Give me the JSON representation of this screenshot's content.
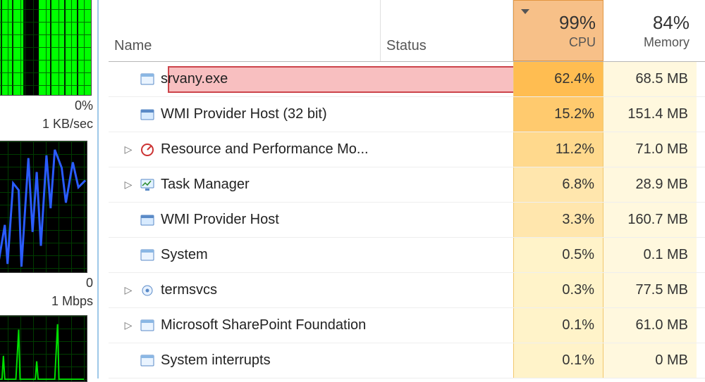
{
  "sidebar": {
    "cpu_label": "0%",
    "kb_label": "1 KB/sec",
    "zero_label": "0",
    "mbps_label": "1 Mbps"
  },
  "header": {
    "name": "Name",
    "status": "Status",
    "cpu_value": "99%",
    "cpu_label": "CPU",
    "mem_value": "84%",
    "mem_label": "Memory"
  },
  "rows": [
    {
      "expandable": false,
      "icon": "window",
      "name": "srvany.exe",
      "cpu": "62.4%",
      "mem": "68.5 MB",
      "heat": "heat-0",
      "highlight": true
    },
    {
      "expandable": false,
      "icon": "gear",
      "name": "WMI Provider Host (32 bit)",
      "cpu": "15.2%",
      "mem": "151.4 MB",
      "heat": "heat-1"
    },
    {
      "expandable": true,
      "icon": "meter",
      "name": "Resource and Performance Mo...",
      "cpu": "11.2%",
      "mem": "71.0 MB",
      "heat": "heat-2"
    },
    {
      "expandable": true,
      "icon": "monitor",
      "name": "Task Manager",
      "cpu": "6.8%",
      "mem": "28.9 MB",
      "heat": "heat-3"
    },
    {
      "expandable": false,
      "icon": "gear",
      "name": "WMI Provider Host",
      "cpu": "3.3%",
      "mem": "160.7 MB",
      "heat": "heat-3"
    },
    {
      "expandable": false,
      "icon": "window",
      "name": "System",
      "cpu": "0.5%",
      "mem": "0.1 MB",
      "heat": "heat-light"
    },
    {
      "expandable": true,
      "icon": "cog",
      "name": "termsvcs",
      "cpu": "0.3%",
      "mem": "77.5 MB",
      "heat": "heat-light"
    },
    {
      "expandable": true,
      "icon": "window",
      "name": "Microsoft SharePoint Foundation",
      "cpu": "0.1%",
      "mem": "61.0 MB",
      "heat": "heat-light"
    },
    {
      "expandable": false,
      "icon": "window",
      "name": "System interrupts",
      "cpu": "0.1%",
      "mem": "0 MB",
      "heat": "heat-light"
    }
  ]
}
